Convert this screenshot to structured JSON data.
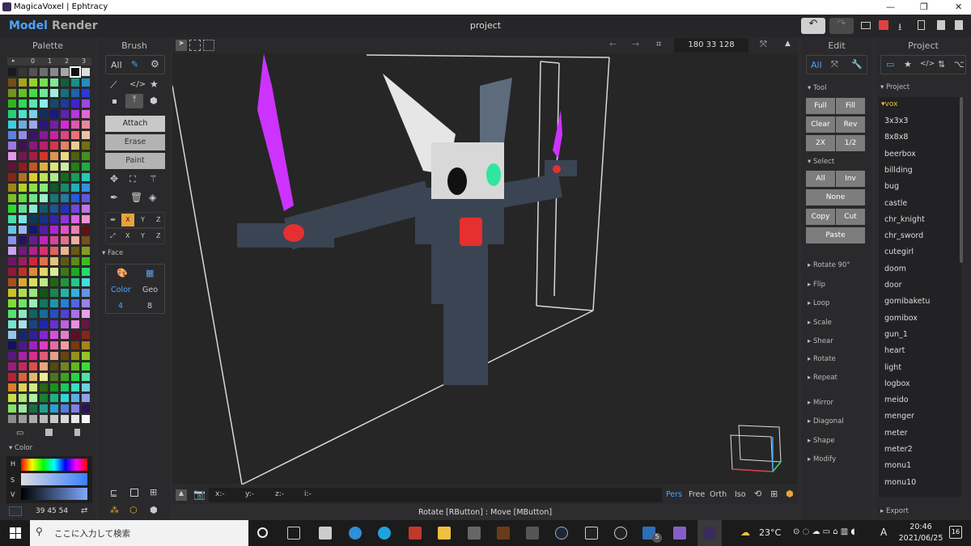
{
  "window": {
    "title": "MagicaVoxel | Ephtracy",
    "min": "—",
    "max": "❐",
    "close": "✕"
  },
  "tabs": {
    "model": "Model",
    "render": "Render"
  },
  "project_title": "project",
  "palette": {
    "header": "Palette",
    "cols": [
      "▸",
      "0",
      "1",
      "2",
      "3"
    ]
  },
  "brush": {
    "header": "Brush",
    "all": "All",
    "attach": "Attach",
    "erase": "Erase",
    "paint": "Paint",
    "axes1": [
      "X",
      "Y",
      "Z"
    ],
    "axes2": [
      "X",
      "Y",
      "Z"
    ],
    "face_label": "Face",
    "color_label": "Color",
    "geo_label": "Geo",
    "color_count": "4",
    "geo_count": "8"
  },
  "color": {
    "header": "Color",
    "h": "H",
    "s": "S",
    "v": "V",
    "rgb": "39 45 54"
  },
  "viewport": {
    "coords": "180 33 128",
    "x": "x:-",
    "y": "y:-",
    "z": "z:-",
    "i": "i:-",
    "views": [
      "Pers",
      "Free",
      "Orth",
      "Iso"
    ],
    "status": "Rotate [RButton] : Move [MButton]"
  },
  "edit": {
    "header": "Edit",
    "all": "All",
    "tool": "Tool",
    "tool_btns": [
      "Full",
      "Fill",
      "Clear",
      "Rev",
      "2X",
      "1/2"
    ],
    "select": "Select",
    "select_btns": [
      "All",
      "Inv"
    ],
    "none": "None",
    "copy": "Copy",
    "cut": "Cut",
    "paste": "Paste",
    "ops": [
      "Rotate 90°",
      "Flip",
      "Loop",
      "Scale",
      "Shear",
      "Rotate",
      "Repeat"
    ],
    "ops2": [
      "Mirror",
      "Diagonal",
      "Shape",
      "Modify"
    ]
  },
  "project": {
    "header": "Project",
    "section": "Project",
    "folder": "vox",
    "items": [
      "3x3x3",
      "8x8x8",
      "beerbox",
      "billding",
      "bug",
      "castle",
      "chr_knight",
      "chr_sword",
      "cutegirl",
      "doom",
      "door",
      "gomibaketu",
      "gomibox",
      "gun_1",
      "heart",
      "light",
      "logbox",
      "meido",
      "menger",
      "meter",
      "meter2",
      "monu1",
      "monu10"
    ],
    "export": "Export"
  },
  "taskbar": {
    "search": "ここに入力して検索",
    "weather": "23°C",
    "ime": "A",
    "time": "20:46",
    "date": "2021/06/25",
    "badge_mail": "5",
    "notif": "16"
  },
  "colors": {
    "accent": "#1e90ff",
    "selected_axis": "#e8a33a",
    "magenta": "#cc33ff"
  }
}
